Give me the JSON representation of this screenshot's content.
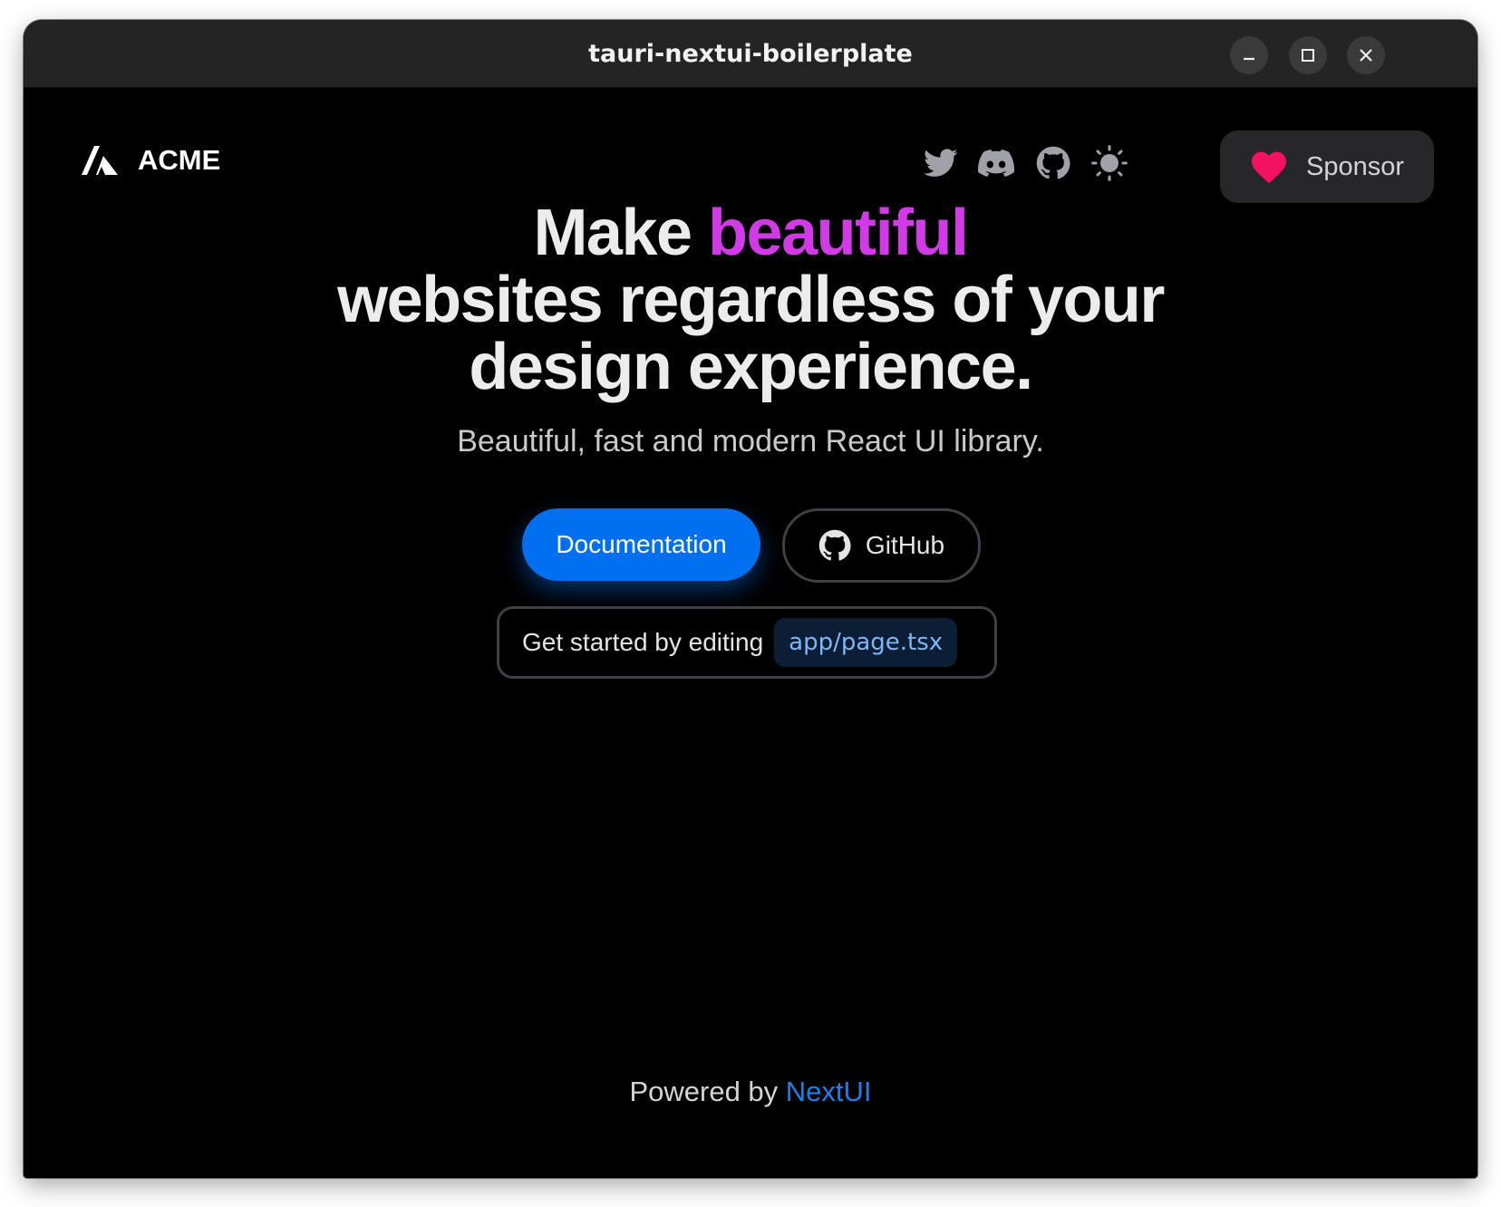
{
  "window": {
    "title": "tauri-nextui-boilerplate",
    "controls": {
      "minimize_icon": "minimize-icon",
      "maximize_icon": "maximize-icon",
      "close_icon": "close-icon"
    }
  },
  "navbar": {
    "brand": {
      "logo_icon": "acme-logo-icon",
      "name": "ACME"
    },
    "icons": [
      "twitter-icon",
      "discord-icon",
      "github-icon",
      "sun-icon"
    ],
    "sponsor": {
      "icon": "heart-icon",
      "label": "Sponsor"
    }
  },
  "hero": {
    "title_part1": "Make ",
    "title_accent": "beautiful",
    "title_line2": "websites regardless of your",
    "title_line3": "design experience.",
    "subtitle": "Beautiful, fast and modern React UI library."
  },
  "actions": {
    "documentation_label": "Documentation",
    "github_label": "GitHub"
  },
  "snippet": {
    "text": "Get started by editing",
    "code": "app/page.tsx"
  },
  "footer": {
    "prefix": "Powered by",
    "link": "NextUI"
  },
  "colors": {
    "accent": "#d13ae6",
    "primary": "#0070f0",
    "link": "#1f7fe8",
    "heart": "#f31260"
  }
}
